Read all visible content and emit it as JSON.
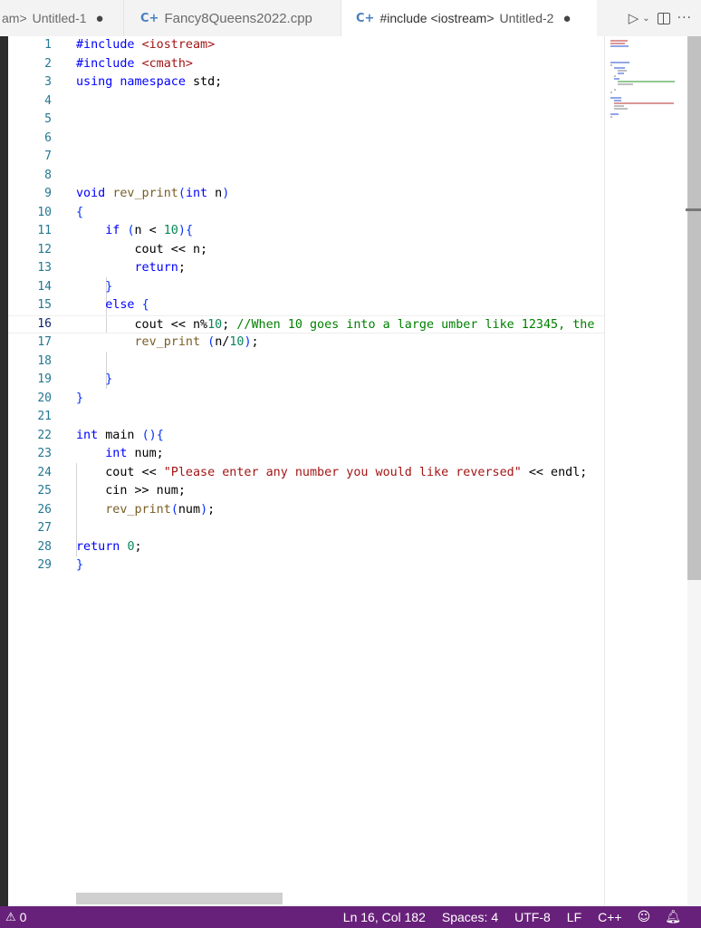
{
  "tabs": [
    {
      "path_fragment": "am>",
      "title": "Untitled-1",
      "dirty": "●",
      "icon": "cpp-icon",
      "active": false
    },
    {
      "title": "Fancy8Queens2022.cpp",
      "icon": "cpp-icon",
      "active": false
    },
    {
      "path": "#include <iostream>",
      "title": "Untitled-2",
      "dirty": "●",
      "icon": "cpp-icon",
      "active": true
    }
  ],
  "editor_actions": [
    "run-icon",
    "chevron-down-icon",
    "split-editor-icon",
    "more-actions-icon"
  ],
  "editor": {
    "line_numbers": [
      "1",
      "2",
      "3",
      "4",
      "5",
      "6",
      "7",
      "8",
      "9",
      "10",
      "11",
      "12",
      "13",
      "14",
      "15",
      "16",
      "17",
      "18",
      "19",
      "20",
      "21",
      "22",
      "23",
      "24",
      "25",
      "26",
      "27",
      "28",
      "29"
    ],
    "active_line": 16,
    "code_lines": [
      "#include <iostream>",
      "#include <cmath>",
      "using namespace std;",
      "",
      "",
      "",
      "",
      "",
      "void rev_print(int n)",
      "{",
      "    if (n < 10){",
      "        cout << n;",
      "        return;",
      "    }",
      "    else {",
      "        cout << n%10; //When 10 goes into a large umber like 12345, the",
      "        rev_print (n/10);",
      "",
      "    }",
      "}",
      "",
      "int main (){",
      "    int num;",
      "    cout << \"Please enter any number you would like reversed\" << endl;",
      "    cin >> num;",
      "    rev_print(num);",
      "",
      "return 0;",
      "}"
    ]
  },
  "status_bar": {
    "problems_icon": "warning-icon",
    "problems_count": "0",
    "cursor_position": "Ln 16, Col 182",
    "indentation": "Spaces: 4",
    "encoding": "UTF-8",
    "line_ending": "LF",
    "language": "C++",
    "right_icons": [
      "feedback-icon",
      "notifications-bell-icon"
    ]
  },
  "colors": {
    "status_bar_bg": "#68217a",
    "keyword": "#0000ff",
    "string": "#a31515",
    "number": "#098658",
    "comment": "#008000",
    "line_number": "#237893"
  }
}
